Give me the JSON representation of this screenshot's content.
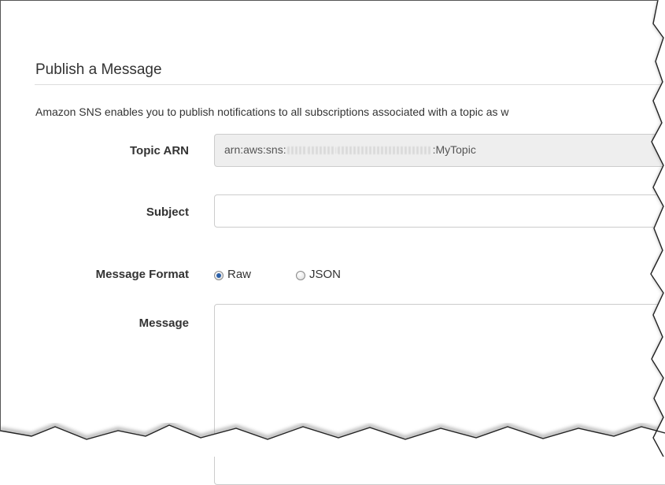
{
  "page": {
    "title": "Publish a Message",
    "description": "Amazon SNS enables you to publish notifications to all subscriptions associated with a topic as w"
  },
  "form": {
    "topic_arn": {
      "label": "Topic ARN",
      "value_prefix": "arn:aws:sns:",
      "value_suffix": ":MyTopic"
    },
    "subject": {
      "label": "Subject",
      "value": ""
    },
    "message_format": {
      "label": "Message Format",
      "options": [
        {
          "label": "Raw",
          "checked": true
        },
        {
          "label": "JSON",
          "checked": false
        }
      ]
    },
    "message": {
      "label": "Message",
      "value": ""
    }
  },
  "colors": {
    "text": "#333333",
    "readonly_background": "#eeeeee",
    "border": "#cccccc",
    "radio_selected": "#2a5fa8"
  }
}
